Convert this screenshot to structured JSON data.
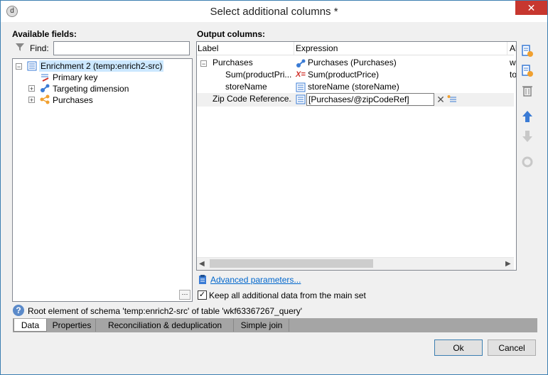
{
  "window": {
    "title": "Select additional columns *",
    "close_glyph": "✕"
  },
  "left": {
    "heading": "Available fields:",
    "find_label": "Find:",
    "find_value": "",
    "tree": [
      {
        "label": "Enrichment 2 (temp:enrich2-src)",
        "icon": "list-icon",
        "expander": "−"
      },
      {
        "label": "Primary key",
        "icon": "key-list-icon"
      },
      {
        "label": "Targeting dimension",
        "icon": "link-icon",
        "expander": "+"
      },
      {
        "label": "Purchases",
        "icon": "share-icon",
        "expander": "+"
      }
    ]
  },
  "right": {
    "heading": "Output columns:",
    "columns": [
      "Label",
      "Expression",
      "Al"
    ],
    "rows": [
      {
        "label": "Purchases",
        "expression": "Purchases (Purchases)",
        "alias": "w",
        "expander": "−"
      },
      {
        "label": "Sum(productPri...",
        "expression": "Sum(productPrice)",
        "alias": "to"
      },
      {
        "label": "storeName",
        "expression": "storeName (storeName)",
        "alias": ""
      },
      {
        "label": "Zip Code Reference...",
        "expression": "[Purchases/@zipCodeRef]",
        "alias": ""
      }
    ],
    "advanced_link": "Advanced parameters...",
    "keep_label": "Keep all additional data from the main set",
    "keep_checked": "✓"
  },
  "status": "Root element of schema 'temp:enrich2-src' of table 'wkf63367267_query'",
  "tabs": [
    "Data",
    "Properties",
    "Reconciliation & deduplication",
    "Simple join"
  ],
  "buttons": {
    "ok": "Ok",
    "cancel": "Cancel"
  },
  "ellipsis": "···",
  "colors": {
    "accent": "#3c7fb1",
    "close": "#c7372f",
    "link": "#0066cc",
    "selection": "#cce8ff"
  }
}
